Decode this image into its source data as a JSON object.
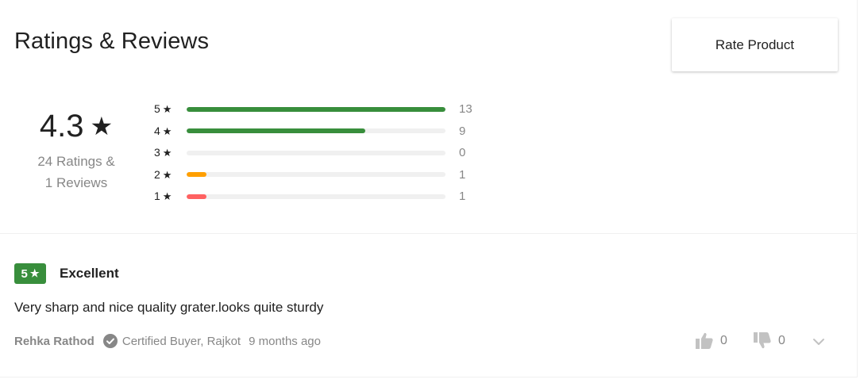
{
  "header": {
    "title": "Ratings & Reviews",
    "rate_button": "Rate Product"
  },
  "summary": {
    "average": "4.3",
    "star": "★",
    "ratings_line": "24 Ratings &",
    "reviews_line": "1 Reviews"
  },
  "breakdown": [
    {
      "stars": "5",
      "count": "13",
      "fraction": 1.0,
      "color": "#388e3c"
    },
    {
      "stars": "4",
      "count": "9",
      "fraction": 0.69,
      "color": "#388e3c"
    },
    {
      "stars": "3",
      "count": "0",
      "fraction": 0.0,
      "color": "#388e3c"
    },
    {
      "stars": "2",
      "count": "1",
      "fraction": 0.077,
      "color": "#ff9f00"
    },
    {
      "stars": "1",
      "count": "1",
      "fraction": 0.077,
      "color": "#ff6161"
    }
  ],
  "review": {
    "rating": "5",
    "title": "Excellent",
    "text": "Very sharp and nice quality grater.looks quite sturdy",
    "author": "Rehka Rathod",
    "certified": "Certified Buyer, Rajkot",
    "time": "9 months ago",
    "likes": "0",
    "dislikes": "0"
  },
  "icons": {
    "check": "certified-check-icon",
    "like": "thumbs-up-icon",
    "dislike": "thumbs-down-icon",
    "expand": "chevron-down-icon"
  }
}
